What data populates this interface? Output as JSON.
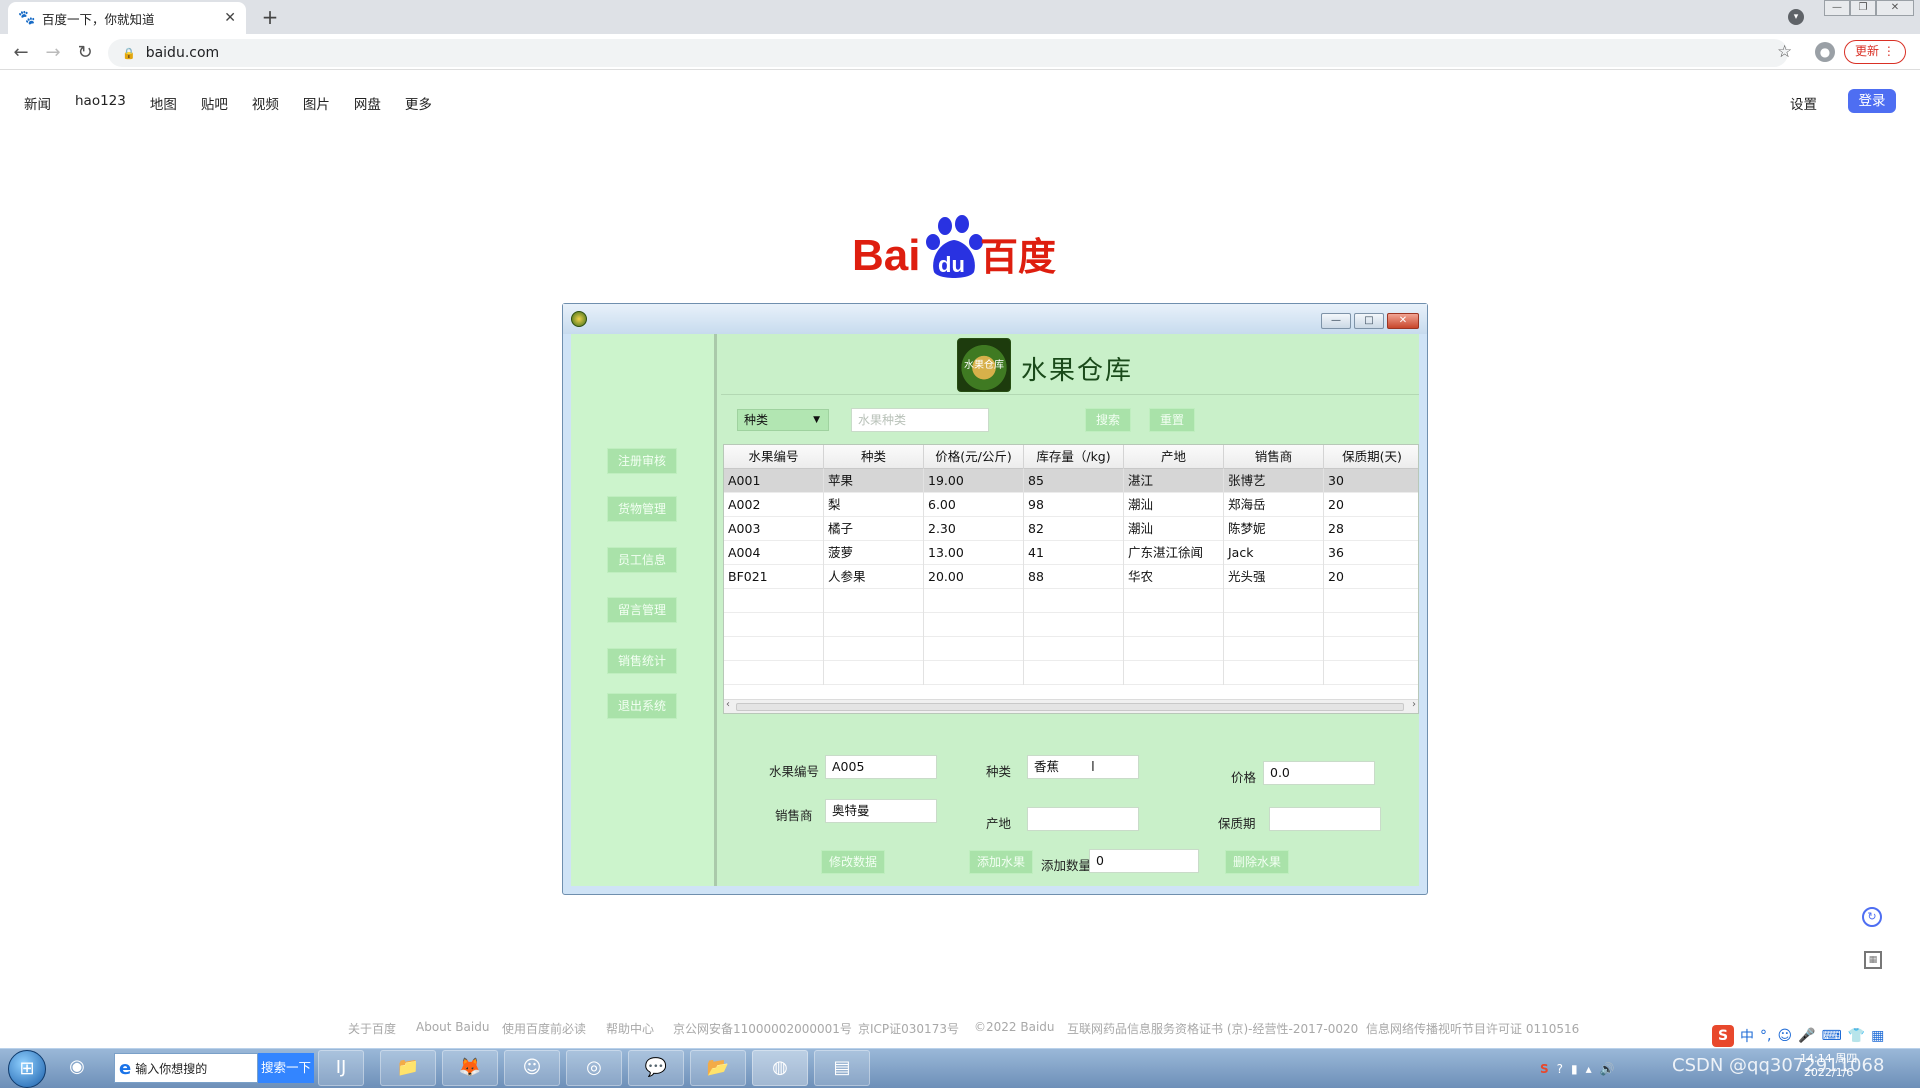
{
  "browser": {
    "tab_title": "百度一下，你就知道",
    "url": "baidu.com",
    "update_label": "更新"
  },
  "baidu_nav": {
    "items": [
      "新闻",
      "hao123",
      "地图",
      "贴吧",
      "视频",
      "图片",
      "网盘",
      "更多"
    ],
    "settings": "设置",
    "login": "登录"
  },
  "logo": {
    "part1": "Bai",
    "part2": "du",
    "part3": "百度"
  },
  "app": {
    "title": "水果仓库",
    "logo_text": "水果仓库",
    "sidebar": [
      "注册审核",
      "货物管理",
      "员工信息",
      "留言管理",
      "销售统计",
      "退出系统"
    ],
    "search": {
      "combo_value": "种类",
      "input_placeholder": "水果种类",
      "search_label": "搜索",
      "reset_label": "重置"
    },
    "table": {
      "columns": [
        "水果编号",
        "种类",
        "价格(元/公斤)",
        "库存量（/kg)",
        "产地",
        "销售商",
        "保质期(天)"
      ],
      "rows": [
        [
          "A001",
          "苹果",
          "19.00",
          "85",
          "湛江",
          "张博艺",
          "30"
        ],
        [
          "A002",
          "梨",
          "6.00",
          "98",
          "潮汕",
          "郑海岳",
          "20"
        ],
        [
          "A003",
          "橘子",
          "2.30",
          "82",
          "潮汕",
          "陈梦妮",
          "28"
        ],
        [
          "A004",
          "菠萝",
          "13.00",
          "41",
          "广东湛江徐闻",
          "Jack",
          "36"
        ],
        [
          "BF021",
          "人参果",
          "20.00",
          "88",
          "华农",
          "光头强",
          "20"
        ]
      ],
      "selected_row": 0
    },
    "form": {
      "id_label": "水果编号",
      "id_value": "A005",
      "type_label": "种类",
      "type_value": "香蕉",
      "price_label": "价格",
      "price_value": "0.0",
      "seller_label": "销售商",
      "seller_value": "奥特曼",
      "origin_label": "产地",
      "origin_value": "",
      "shelf_label": "保质期",
      "shelf_value": "",
      "modify_label": "修改数据",
      "add_label": "添加水果",
      "qty_label": "添加数量",
      "qty_value": "0",
      "delete_label": "删除水果"
    }
  },
  "footer": [
    "关于百度",
    "About Baidu",
    "使用百度前必读",
    "帮助中心",
    "京公网安备11000002000001号",
    "京ICP证030173号",
    "©2022 Baidu",
    "互联网药品信息服务资格证书 (京)-经营性-2017-0020",
    "信息网络传播视听节目许可证 0110516"
  ],
  "taskbar": {
    "search_placeholder": "输入你想搜的",
    "search_button": "搜索一下",
    "ime_label": "中",
    "time": "14:14 周四",
    "date": "2022/1/6",
    "watermark": "CSDN @qq3072911068"
  },
  "colors": {
    "app_bg": "#c9f0c9",
    "button_green": "#a9e2a9",
    "baidu_blue": "#4e6ef2",
    "baidu_red": "#de1e0f"
  }
}
